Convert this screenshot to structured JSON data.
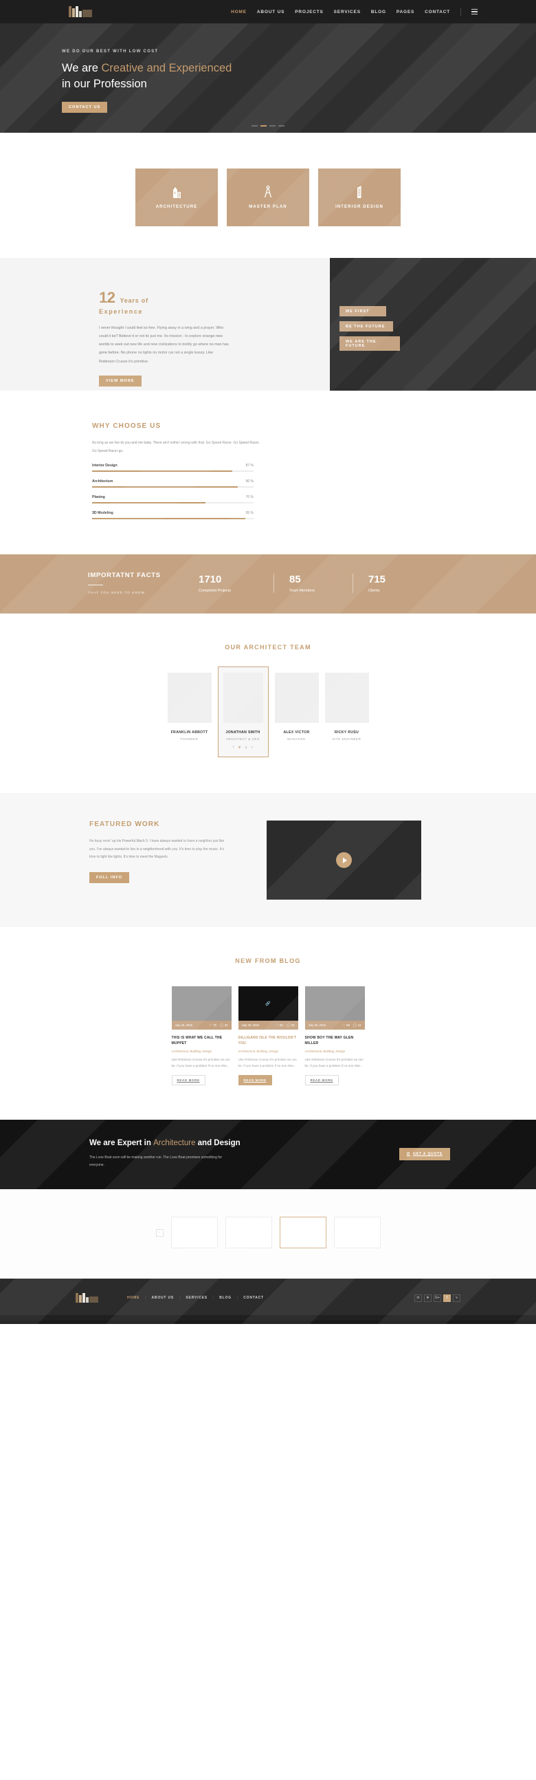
{
  "header": {
    "logo_name": "architect-logo",
    "nav": [
      {
        "label": "HOME",
        "active": true
      },
      {
        "label": "ABOUT US",
        "active": false
      },
      {
        "label": "PROJECTS",
        "active": false
      },
      {
        "label": "SERVICES",
        "active": false
      },
      {
        "label": "BLOG",
        "active": false
      },
      {
        "label": "PAGES",
        "active": false
      },
      {
        "label": "CONTACT",
        "active": false
      }
    ],
    "menu_icon": "hamburger-icon"
  },
  "hero": {
    "kicker": "WE DO OUR BEST WITH LOW COST",
    "title_plain": "We are ",
    "title_accent": "Creative and Experienced",
    "title_line2": "in our Profession",
    "button": "CONTACT US",
    "slides": 4,
    "active_slide": 2
  },
  "services": [
    {
      "label": "ARCHITECTURE",
      "icon": "buildings-icon"
    },
    {
      "label": "MASTER PLAN",
      "icon": "compass-icon"
    },
    {
      "label": "INTERIOR DESIGN",
      "icon": "tower-icon"
    }
  ],
  "experience": {
    "number": "12",
    "years_label": "Years of",
    "experience_label": "Experience",
    "paragraph": "I never thought I could feel so free. Flying away in a wing and a prayer. Who could it be? Believe it or not its just me. Its mission - to explore strange new worlds to seek out new life and new civilizations to boldly go where no man has gone before. No phone no lights no motor car not a single luxury. Like Robinson Crusoe it's primitive.",
    "button": "VIEW MORE",
    "tabs": [
      {
        "label": "WE FIRST"
      },
      {
        "label": "BE THE FUTURE"
      },
      {
        "label": "WE ARE THE FUTURE"
      }
    ]
  },
  "why": {
    "title": "WHY CHOOSE US",
    "paragraph": "As long as we live its you and me baby. There ain't nothin' wrong with that. Go Speed Racer. Go Speed Racer. Go Speed Racer go.",
    "skills": [
      {
        "name": "Interior Design",
        "value": 87,
        "pct": "87 %"
      },
      {
        "name": "Architecture",
        "value": 90,
        "pct": "90 %"
      },
      {
        "name": "Planing",
        "value": 70,
        "pct": "70 %"
      },
      {
        "name": "3D Modeling",
        "value": 95,
        "pct": "95 %"
      }
    ]
  },
  "facts": {
    "title": "IMPORTATNT FACTS",
    "subtitle": "THAT YOU NEED TO KNOW",
    "stats": [
      {
        "number": "1710",
        "label": "Completed Projects"
      },
      {
        "number": "85",
        "label": "Team Members"
      },
      {
        "number": "715",
        "label": "Clients"
      }
    ]
  },
  "team": {
    "title": "OUR ARCHITECT TEAM",
    "members": [
      {
        "name": "FRANKLIN ABBOTT",
        "role": "FOUNDER",
        "featured": false
      },
      {
        "name": "JONATHAN SMITH",
        "role": "ARCHITECT & CEO",
        "featured": true,
        "socials": [
          "f",
          "❦",
          "p",
          "v"
        ]
      },
      {
        "name": "ALEX VICTOR",
        "role": "MANAGER",
        "featured": false
      },
      {
        "name": "RICKY RUSU",
        "role": "SITE ENGINEER",
        "featured": false
      }
    ]
  },
  "featured_work": {
    "title": "FEATURED WORK",
    "paragraph": "He busy revin' up his Powerful Mach 5. I have always wanted to have a neighbor just like you. I've always wanted to live in a neighborhood with you. It's time to play the music. It's time to light the lights. It's time to meet the Muppets.",
    "button": "FULL INFO",
    "play_icon": "play-icon"
  },
  "blog": {
    "title": "NEW FROM BLOG",
    "posts": [
      {
        "date": "July 26, 2016",
        "likes": "75",
        "comments": "32",
        "title": "THIS IS WHAT WE CALL THE MUPPET",
        "cats": "Architectural, Building, Design",
        "excerpt": "Like Robinson Crusoe it's primitive as can be. If you have a problem if no one else...",
        "read_more": "READ MORE",
        "dark": false
      },
      {
        "date": "July 28, 2016",
        "likes": "62",
        "comments": "28",
        "title": "GILLIGANS ISLE THE WOULDN'T YOU",
        "cats": "Architectural, Building, Design",
        "excerpt": "Like Robinson Crusoe it's primitive as can be. If you have a problem if no one else...",
        "read_more": "READ MORE",
        "dark": true
      },
      {
        "date": "July 29, 2016",
        "likes": "58",
        "comments": "12",
        "title": "SHOW BOY THE WAY GLEN MILLER",
        "cats": "Architectural, Building, Design",
        "excerpt": "Like Robinson Crusoe it's primitive as can be. If you have a problem if no one else...",
        "read_more": "READ MORE",
        "dark": false
      }
    ]
  },
  "cta": {
    "heading_a": "We are Expert in ",
    "heading_accent": "Architecture",
    "heading_b": " and Design",
    "paragraph": "The Love Boat soon will be making another run. The Love Boat promises something for everyone.",
    "button": "GET A QUOTE",
    "button_icon": "check-square-icon"
  },
  "clients": {
    "prev_icon": "‹",
    "boxes": 4,
    "active_box": 2
  },
  "footer": {
    "nav": [
      {
        "label": "HOME",
        "active": true
      },
      {
        "label": "ABOUT US",
        "active": false
      },
      {
        "label": "SERVICES",
        "active": false
      },
      {
        "label": "BLOG",
        "active": false
      },
      {
        "label": "CONTACT",
        "active": false
      }
    ],
    "socials": [
      {
        "icon": "linkedin-icon",
        "glyph": "in",
        "on": false
      },
      {
        "icon": "twitter-icon",
        "glyph": "❦",
        "on": false
      },
      {
        "icon": "google-plus-icon",
        "glyph": "G+",
        "on": false
      },
      {
        "icon": "facebook-icon",
        "glyph": "f",
        "on": true
      },
      {
        "icon": "vimeo-icon",
        "glyph": "v",
        "on": false
      }
    ]
  },
  "colors": {
    "accent": "#c49a6c",
    "accent_fill": "#c5a382",
    "dark": "#2e2e2e",
    "darker": "#131313"
  }
}
